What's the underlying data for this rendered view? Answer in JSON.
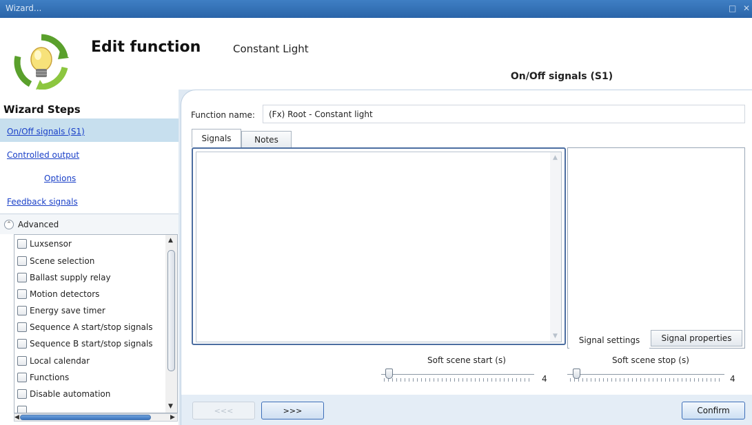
{
  "window": {
    "title": "Wizard..."
  },
  "header": {
    "title": "Edit function",
    "function_type": "Constant Light",
    "step_tab": "On/Off signals (S1)"
  },
  "wizard": {
    "title": "Wizard Steps",
    "steps": [
      "On/Off signals (S1)",
      "Controlled output",
      "Options",
      "Feedback signals"
    ],
    "advanced_label": "Advanced",
    "advanced_items": [
      "Luxsensor",
      "Scene selection",
      "Ballast supply relay",
      "Motion detectors",
      "Energy save timer",
      "Sequence A start/stop signals",
      "Sequence B start/stop signals",
      "Local calendar",
      "Functions",
      "Disable automation"
    ]
  },
  "main": {
    "function_name_label": "Function name:",
    "function_name_value": "(Fx) Root - Constant light",
    "tabs": [
      "Signals",
      "Notes"
    ],
    "right_tabs": [
      "Signal settings",
      "Signal properties"
    ],
    "soft_start_label": "Soft scene start (s)",
    "soft_start_value": "4",
    "soft_stop_label": "Soft scene stop (s)",
    "soft_stop_value": "4",
    "prev_button": "<<<",
    "next_button": ">>>",
    "confirm_button": "Confirm"
  },
  "colors": {
    "titlebar": "#2f6db5",
    "link": "#1a40c8",
    "selected_step": "#c7dfee",
    "accent_border": "#3b6db8"
  }
}
